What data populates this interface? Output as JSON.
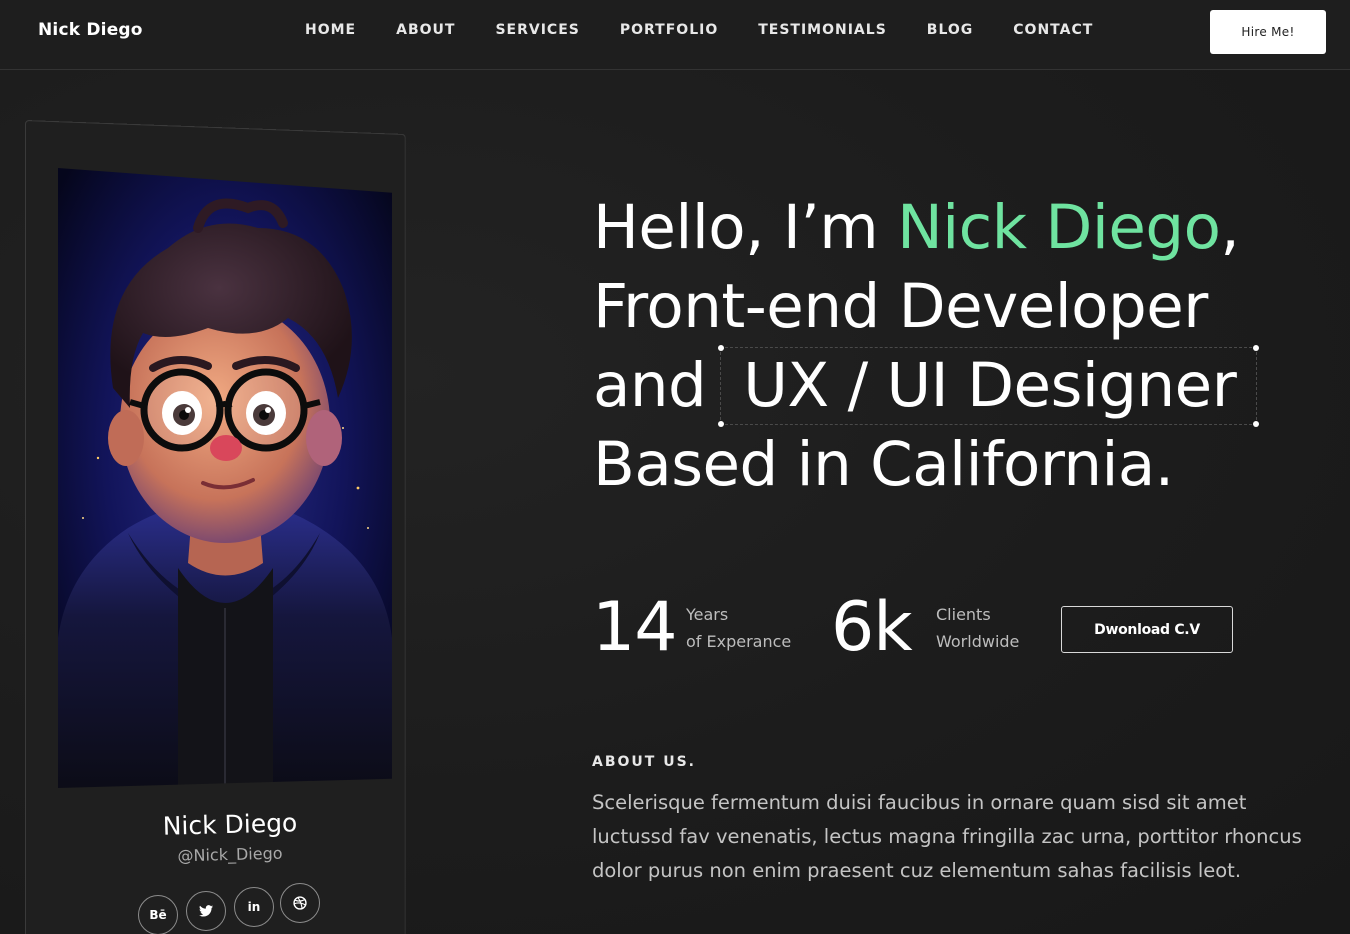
{
  "header": {
    "brand": "Nick Diego",
    "nav": [
      "HOME",
      "ABOUT",
      "SERVICES",
      "PORTFOLIO",
      "TESTIMONIALS",
      "BLOG",
      "CONTACT"
    ],
    "cta_label": "Hire Me!"
  },
  "profile": {
    "name": "Nick Diego",
    "handle": "@Nick_Diego",
    "socials": [
      {
        "icon": "behance-icon",
        "glyph": "Bē"
      },
      {
        "icon": "twitter-icon",
        "glyph": ""
      },
      {
        "icon": "linkedin-icon",
        "glyph": "in"
      },
      {
        "icon": "dribbble-icon",
        "glyph": ""
      }
    ]
  },
  "hero": {
    "greeting": "Hello, I’m ",
    "name": "Nick Diego",
    "comma": ",",
    "line2": "Front-end Developer",
    "line3_prefix": "and",
    "role": "UX / UI Designer",
    "line4": "Based in California."
  },
  "stats": [
    {
      "value": "14",
      "label_1": "Years",
      "label_2": "of Experance"
    },
    {
      "value": "6k",
      "label_1": "Clients",
      "label_2": "Worldwide"
    }
  ],
  "download_label": "Dwonload C.V",
  "about": {
    "heading": "ABOUT US.",
    "text": "Scelerisque fermentum duisi faucibus in ornare quam sisd sit amet luctussd fav venenatis, lectus magna fringilla zac urna, porttitor rhoncus dolor purus non enim praesent cuz elementum sahas facilisis leot."
  },
  "colors": {
    "background": "#1d1d1d",
    "accent": "#6fe3a0",
    "text": "#ffffff",
    "muted": "#bdbdbd"
  }
}
